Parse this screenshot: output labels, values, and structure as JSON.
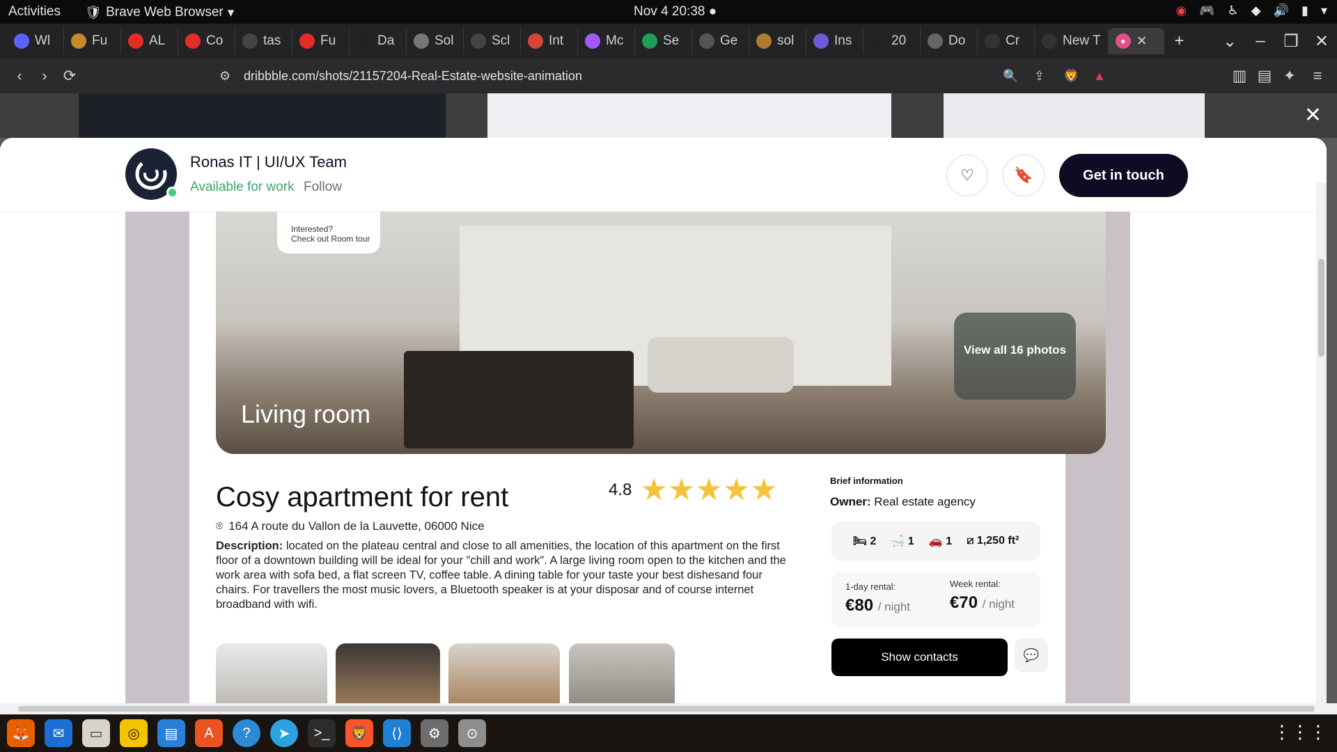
{
  "system": {
    "activities": "Activities",
    "app_name": "Brave Web Browser",
    "clock": "Nov 4  20:38"
  },
  "tabs": [
    {
      "label": "Wl",
      "icon_color": "#5a63ff"
    },
    {
      "label": "Fu",
      "icon_color": "#c98a2a"
    },
    {
      "label": "AL",
      "icon_color": "#e52d27"
    },
    {
      "label": "Co",
      "icon_color": "#e52d27"
    },
    {
      "label": "tas",
      "icon_color": "#444"
    },
    {
      "label": "Fu",
      "icon_color": "#e52d27"
    },
    {
      "label": "Da",
      "icon_color": "#222"
    },
    {
      "label": "Sol",
      "icon_color": "#777"
    },
    {
      "label": "Scl",
      "icon_color": "#444"
    },
    {
      "label": "Int",
      "icon_color": "#d44638"
    },
    {
      "label": "Mc",
      "icon_color": "#a259ff"
    },
    {
      "label": "Se",
      "icon_color": "#1e9e57"
    },
    {
      "label": "Ge",
      "icon_color": "#555"
    },
    {
      "label": "sol",
      "icon_color": "#b07b2c"
    },
    {
      "label": "Ins",
      "icon_color": "#6b5bd6"
    },
    {
      "label": "20",
      "icon_color": "#222"
    },
    {
      "label": "Do",
      "icon_color": "#666"
    },
    {
      "label": "Cr",
      "icon_color": "#333"
    },
    {
      "label": "New T",
      "icon_color": "#333"
    }
  ],
  "active_tab": {
    "label": "",
    "icon_color": "#ea4c89"
  },
  "address": {
    "url": "dribbble.com/shots/21157204-Real-Estate-website-animation"
  },
  "shot_header": {
    "studio": "Ronas IT | UI/UX Team",
    "available": "Available for work",
    "follow": "Follow",
    "get_in_touch": "Get in touch"
  },
  "hero": {
    "bubble_line1": "Interested?",
    "bubble_line2": "Check out Room tour",
    "room_label": "Living room",
    "view_all": "View all 16 photos"
  },
  "listing": {
    "title": "Cosy apartment for rent",
    "rating": "4.8",
    "stars": 5,
    "address": "164 A route du Vallon de la Lauvette, 06000 Nice",
    "desc_label": "Description:",
    "description": " located on the plateau central and close to all amenities, the location of this apartment on the first floor of a downtown building will be ideal for your \"chill and work\".  A large living room open to the kitchen and the work area with sofa bed, a flat screen TV, coffee table. A dining table for your taste your best dishesand four chairs. For travellers the most music lovers, a Bluetooth speaker is at your disposar and of course internet broadband with wifi."
  },
  "info": {
    "brief": "Brief information",
    "owner_label": "Owner:",
    "owner_value": "Real estate agency",
    "bedrooms": "2",
    "baths": "1",
    "cars": "1",
    "area": "1,250 ft²",
    "day_label": "1-day rental:",
    "day_price": "€80",
    "week_label": "Week rental:",
    "week_price": "€70",
    "per_night": "/ night",
    "show_contacts": "Show contacts"
  }
}
